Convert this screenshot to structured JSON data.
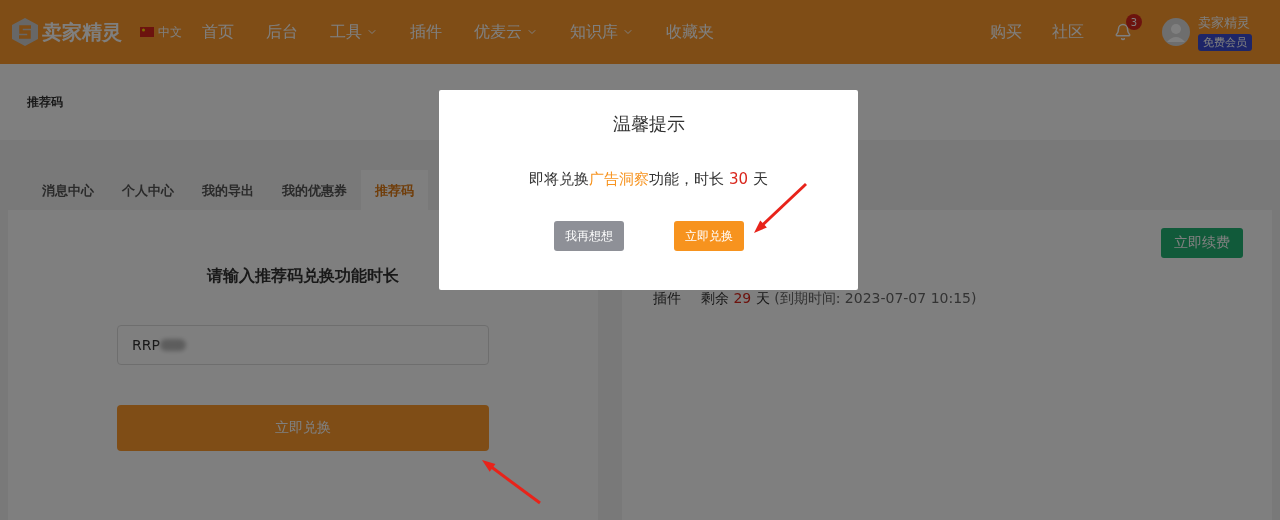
{
  "header": {
    "brand": "卖家精灵",
    "language": "中文",
    "nav": [
      {
        "label": "首页",
        "dropdown": false
      },
      {
        "label": "后台",
        "dropdown": false
      },
      {
        "label": "工具",
        "dropdown": true
      },
      {
        "label": "插件",
        "dropdown": false
      },
      {
        "label": "优麦云",
        "dropdown": true
      },
      {
        "label": "知识库",
        "dropdown": true
      },
      {
        "label": "收藏夹",
        "dropdown": false
      }
    ],
    "links": [
      "购买",
      "社区"
    ],
    "notification_count": "3",
    "user": {
      "name": "卖家精灵",
      "membership": "免费会员"
    }
  },
  "breadcrumb": "推荐码",
  "tabs": [
    {
      "label": "消息中心",
      "selected": false
    },
    {
      "label": "个人中心",
      "selected": false
    },
    {
      "label": "我的导出",
      "selected": false
    },
    {
      "label": "我的优惠券",
      "selected": false
    },
    {
      "label": "推荐码",
      "selected": true
    }
  ],
  "redeem": {
    "title": "请输入推荐码兑换功能时长",
    "code": {
      "value": "RRP",
      "masked": true
    },
    "button": "立即兑换"
  },
  "subscription": {
    "renew_button": "立即续费",
    "items": [
      {
        "name": "插件",
        "remaining": "剩余",
        "days": "29",
        "unit": "天",
        "expiry": "(到期时间: 2023-07-07 10:15)"
      }
    ]
  },
  "dialog": {
    "title": "温馨提示",
    "message": [
      {
        "text": "即将兑换",
        "kind": "plain"
      },
      {
        "text": "广告洞察",
        "kind": "feature"
      },
      {
        "text": "功能，时长 ",
        "kind": "plain"
      },
      {
        "text": "30",
        "kind": "number"
      },
      {
        "text": " 天",
        "kind": "plain"
      }
    ],
    "buttons": [
      {
        "label": "我再想想",
        "kind": "secondary"
      },
      {
        "label": "立即兑换",
        "kind": "primary"
      }
    ]
  }
}
